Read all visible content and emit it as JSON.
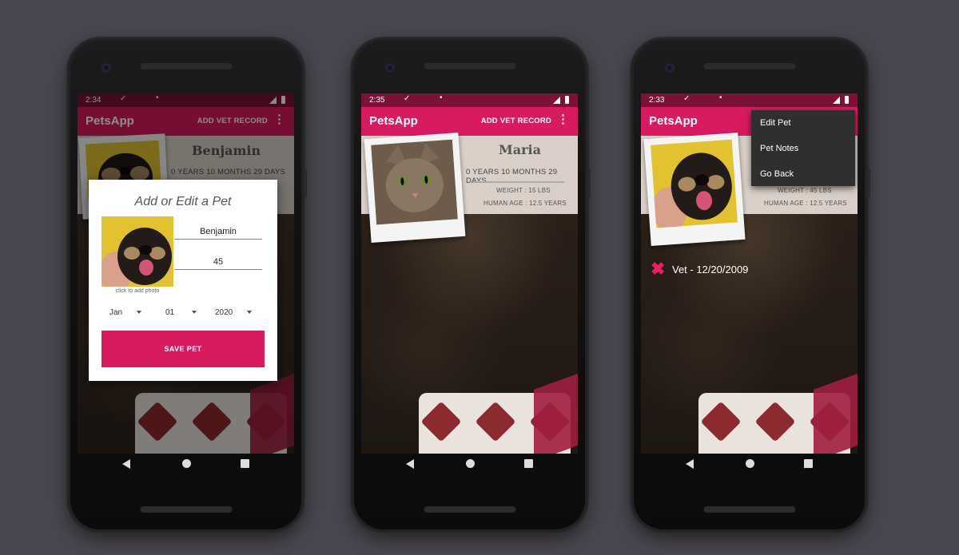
{
  "app_title": "PetsApp",
  "appbar_action": "ADD VET RECORD",
  "menu_glyph": "⋮",
  "phones": [
    {
      "status_time": "2:34",
      "pet": {
        "name": "Benjamin",
        "age": "0 YEARS 10 MONTHS 29 DAYS"
      },
      "dialog": {
        "title": "Add or Edit a Pet",
        "caption": "click to add photo",
        "name_value": "Benjamin",
        "weight_value": "45",
        "month": "Jan",
        "day": "01",
        "year": "2020",
        "save_label": "SAVE PET"
      }
    },
    {
      "status_time": "2:35",
      "pet": {
        "name": "Maria",
        "age": "0 YEARS 10 MONTHS 29 DAYS",
        "weight": "WEIGHT : 15 LBS",
        "human_age": "HUMAN AGE : 12.5 YEARS"
      }
    },
    {
      "status_time": "2:33",
      "pet": {
        "weight": "WEIGHT : 45 LBS",
        "human_age": "HUMAN AGE : 12.5 YEARS"
      },
      "menu": [
        "Edit Pet",
        "Pet Notes",
        "Go Back"
      ],
      "vet_record": "Vet - 12/20/2009"
    }
  ],
  "colors": {
    "accent": "#d81b60",
    "status_bar": "#7a1237",
    "background": "#4a464f"
  }
}
